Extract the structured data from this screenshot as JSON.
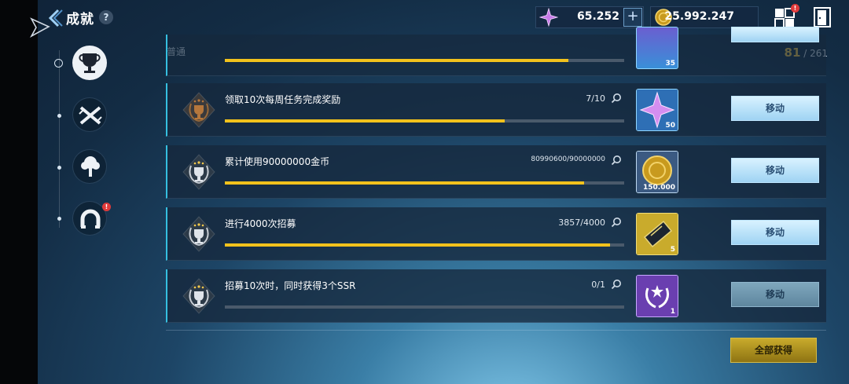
{
  "header": {
    "title": "成就",
    "help_label": "?",
    "gems": "65.252",
    "plus_label": "+",
    "gold": "25.992.247",
    "menu_badge": "!"
  },
  "nav": {
    "items": [
      "trophy",
      "crossed-swords",
      "tree",
      "magnet"
    ],
    "magnet_badge": "!"
  },
  "category": "普通",
  "progress": {
    "done": "81",
    "sep": "/",
    "total": "261"
  },
  "partial_row": {
    "reward_qty": "35"
  },
  "rows": [
    {
      "text": "领取10次每周任务完成奖励",
      "count": "7/10",
      "fraction": 0.7,
      "reward": "purple-star",
      "reward_qty": "50",
      "button": "移动"
    },
    {
      "text": "累计使用90000000金币",
      "count": "80990600/90000000",
      "fraction": 0.9,
      "reward": "gold-coin",
      "reward_qty": "150.000",
      "button": "移动"
    },
    {
      "text": "进行4000次招募",
      "count": "3857/4000",
      "fraction": 0.964,
      "reward": "ticket",
      "reward_qty": "5",
      "button": "移动"
    },
    {
      "text": "招募10次时，同时获得3个SSR",
      "count": "0/1",
      "fraction": 0,
      "reward": "laurel-badge",
      "reward_qty": "1",
      "button": "移动"
    }
  ],
  "collect_all": "全部获得",
  "colors": {
    "accent": "#35bfe0",
    "bar": "#f2c21c",
    "gold_button": "#c9ab2c"
  }
}
